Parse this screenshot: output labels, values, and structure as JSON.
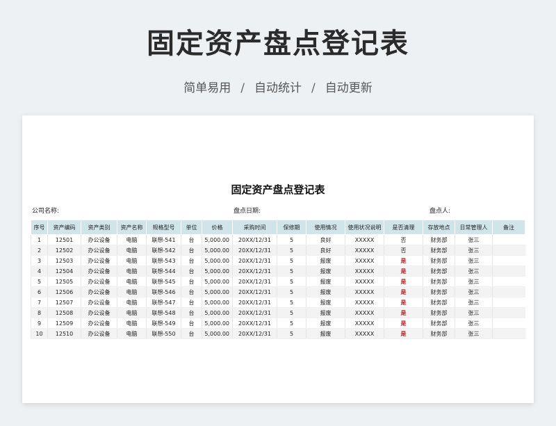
{
  "header": {
    "title": "固定资产盘点登记表",
    "features": [
      "简单易用",
      "自动统计",
      "自动更新"
    ],
    "separator": "/"
  },
  "sheet": {
    "title": "固定资产盘点登记表",
    "company_label": "公司名称:",
    "date_label": "盘点日期:",
    "checker_label": "盘点人:",
    "columns": [
      "序号",
      "资产编码",
      "资产类别",
      "资产名称",
      "规格型号",
      "单位",
      "价格",
      "采购时间",
      "保修期",
      "使用情况",
      "使用状况说明",
      "是否清理",
      "存放地点",
      "日常管理人",
      "备注"
    ],
    "rows": [
      [
        "1",
        "12501",
        "办公设备",
        "电脑",
        "联想-541",
        "台",
        "5,000.00",
        "20XX/12/31",
        "5",
        "良好",
        "XXXXX",
        "否",
        "财务部",
        "张三",
        ""
      ],
      [
        "2",
        "12502",
        "办公设备",
        "电脑",
        "联想-542",
        "台",
        "5,000.00",
        "20XX/12/31",
        "5",
        "良好",
        "XXXXX",
        "否",
        "财务部",
        "张三",
        ""
      ],
      [
        "3",
        "12503",
        "办公设备",
        "电脑",
        "联想-543",
        "台",
        "5,000.00",
        "20XX/12/31",
        "5",
        "报废",
        "XXXXX",
        "是",
        "财务部",
        "张三",
        ""
      ],
      [
        "4",
        "12504",
        "办公设备",
        "电脑",
        "联想-544",
        "台",
        "5,000.00",
        "20XX/12/31",
        "5",
        "报废",
        "XXXXX",
        "是",
        "财务部",
        "张三",
        ""
      ],
      [
        "5",
        "12505",
        "办公设备",
        "电脑",
        "联想-545",
        "台",
        "5,000.00",
        "20XX/12/31",
        "5",
        "报废",
        "XXXXX",
        "是",
        "财务部",
        "张三",
        ""
      ],
      [
        "6",
        "12506",
        "办公设备",
        "电脑",
        "联想-546",
        "台",
        "5,000.00",
        "20XX/12/31",
        "5",
        "报废",
        "XXXXX",
        "是",
        "财务部",
        "张三",
        ""
      ],
      [
        "7",
        "12507",
        "办公设备",
        "电脑",
        "联想-547",
        "台",
        "5,000.00",
        "20XX/12/31",
        "5",
        "报废",
        "XXXXX",
        "是",
        "财务部",
        "张三",
        ""
      ],
      [
        "8",
        "12508",
        "办公设备",
        "电脑",
        "联想-548",
        "台",
        "5,000.00",
        "20XX/12/31",
        "5",
        "报废",
        "XXXXX",
        "是",
        "财务部",
        "张三",
        ""
      ],
      [
        "9",
        "12509",
        "办公设备",
        "电脑",
        "联想-549",
        "台",
        "5,000.00",
        "20XX/12/31",
        "5",
        "报废",
        "XXXXX",
        "是",
        "财务部",
        "张三",
        ""
      ],
      [
        "10",
        "12510",
        "办公设备",
        "电脑",
        "联想-550",
        "台",
        "5,000.00",
        "20XX/12/31",
        "5",
        "报废",
        "XXXXX",
        "是",
        "财务部",
        "张三",
        ""
      ]
    ]
  },
  "colors": {
    "header_bg": "#cfe5ea",
    "clean_yes": "#c0262d",
    "page_bg": "#eef1f4"
  }
}
